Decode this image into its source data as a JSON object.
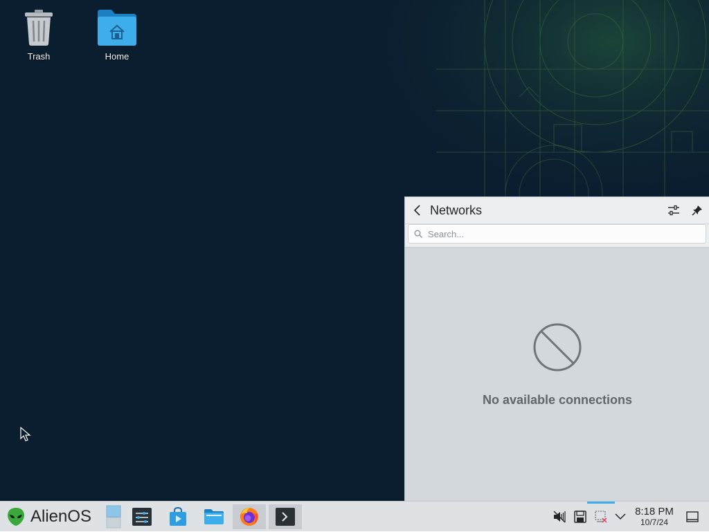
{
  "desktop": {
    "icons": [
      {
        "label": "Trash",
        "icon": "trash-icon"
      },
      {
        "label": "Home",
        "icon": "home-folder-icon"
      }
    ]
  },
  "network_popup": {
    "title": "Networks",
    "search_placeholder": "Search...",
    "empty_message": "No available connections",
    "icons": {
      "back": "chevron-left-icon",
      "settings": "sliders-icon",
      "pin": "pin-icon",
      "empty": "no-entry-icon"
    }
  },
  "taskbar": {
    "launcher_label": "AlienOS",
    "apps": [
      {
        "name": "pager",
        "icon": "virtual-desktop-pager-icon"
      },
      {
        "name": "system-settings",
        "icon": "settings-app-icon"
      },
      {
        "name": "software-center",
        "icon": "store-bag-icon"
      },
      {
        "name": "file-manager",
        "icon": "folder-app-icon"
      },
      {
        "name": "firefox",
        "icon": "firefox-icon"
      },
      {
        "name": "terminal",
        "icon": "terminal-icon"
      }
    ],
    "tray": {
      "icons": [
        "volume-muted-icon",
        "disk-icon",
        "network-disconnected-icon",
        "chevron-down-icon",
        "show-desktop-icon"
      ],
      "time": "8:18 PM",
      "date": "10/7/24"
    }
  },
  "colors": {
    "desktop_bg": "#0b1e30",
    "accent": "#3daee9",
    "panel_bg": "#dfe2e5"
  }
}
